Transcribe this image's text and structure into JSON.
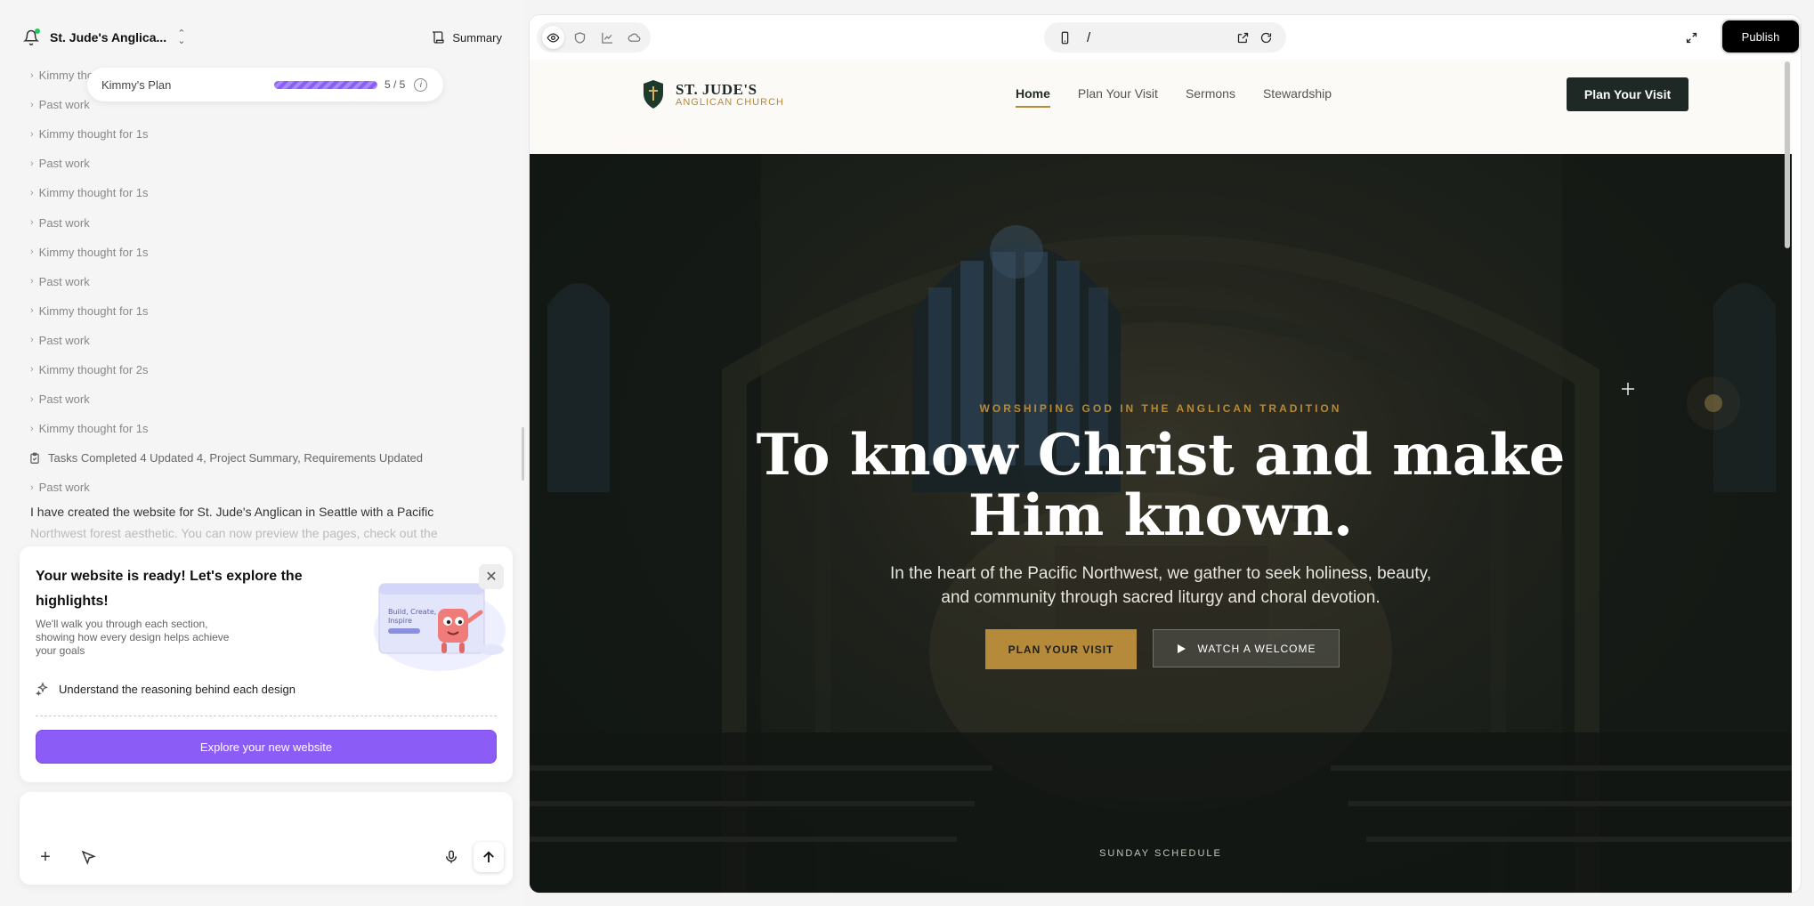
{
  "left": {
    "project_name": "St. Jude's Anglica...",
    "summary_label": "Summary",
    "plan": {
      "label": "Kimmy's Plan",
      "count": "5 / 5",
      "progress": 1.0
    },
    "log": [
      "Kimmy thought for 1s",
      "Past work",
      "Kimmy thought for 1s",
      "Past work",
      "Kimmy thought for 1s",
      "Past work",
      "Kimmy thought for 1s",
      "Past work",
      "Kimmy thought for 1s",
      "Past work",
      "Kimmy thought for 2s",
      "Past work",
      "Kimmy thought for 1s"
    ],
    "task_line": "Tasks Completed 4 Updated 4, Project Summary, Requirements Updated",
    "past_work_final": "Past work",
    "message_line1": "I have created the website for St. Jude's Anglican in Seattle with a Pacific",
    "message_line2": "Northwest forest aesthetic. You can now preview the pages, check out the",
    "card": {
      "title": "Your website is ready! Let's explore the highlights!",
      "desc": "We'll walk you through each section, showing how every design helps achieve your goals",
      "feature": "Understand the reasoning behind each design",
      "cta": "Explore your new website",
      "illus_text1": "Build, Create,",
      "illus_text2": "Inspire"
    }
  },
  "toolbar": {
    "url_path": "/",
    "publish_label": "Publish"
  },
  "site": {
    "brand_name": "ST. JUDE'S",
    "brand_sub": "ANGLICAN CHURCH",
    "nav": [
      "Home",
      "Plan Your Visit",
      "Sermons",
      "Stewardship"
    ],
    "nav_cta": "Plan Your Visit",
    "hero": {
      "eyebrow": "WORSHIPING GOD IN THE ANGLICAN TRADITION",
      "title": "To know Christ and make Him known.",
      "subtitle": "In the heart of the Pacific Northwest, we gather to seek holiness, beauty, and community through sacred liturgy and choral devotion.",
      "btn_primary": "PLAN YOUR VISIT",
      "btn_secondary": "WATCH A WELCOME",
      "footer": "SUNDAY SCHEDULE"
    }
  },
  "colors": {
    "accent_purple": "#8b5cf6",
    "gold": "#b58a3a",
    "forest_dark": "#1e2925"
  }
}
